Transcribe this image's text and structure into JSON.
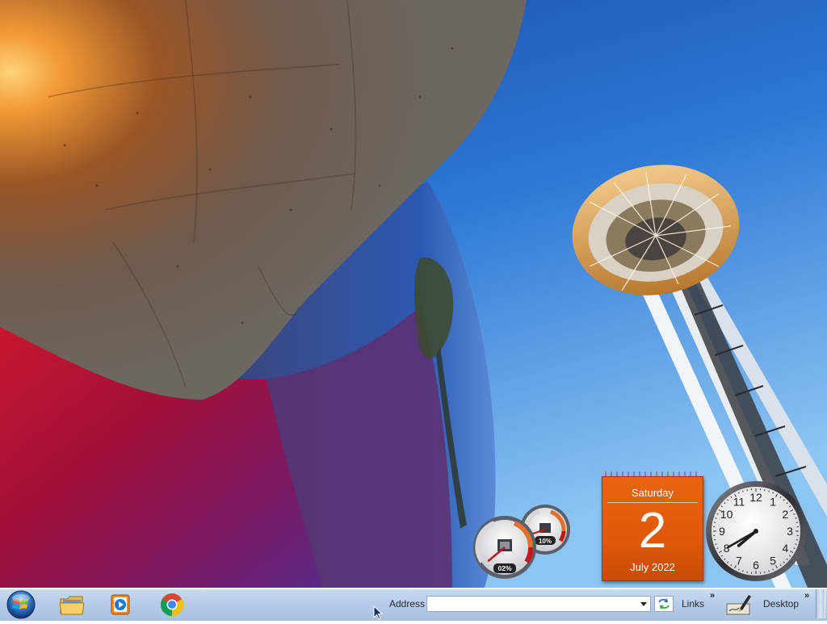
{
  "desktop": {
    "wallpaper": "seattle-space-needle-and-museum"
  },
  "gadgets": {
    "cpu_meter": {
      "cpu_label": "02%",
      "memory_label": "10%",
      "cpu_percent": 2,
      "memory_percent": 10
    },
    "calendar": {
      "weekday": "Saturday",
      "day": "2",
      "month_year": "July 2022",
      "color": "#e0600c"
    },
    "clock": {
      "numbers": [
        "12",
        "1",
        "2",
        "3",
        "4",
        "5",
        "6",
        "7",
        "8",
        "9",
        "10",
        "11"
      ],
      "hour": 7,
      "minute": 40
    }
  },
  "taskbar": {
    "start_icon": "windows-start-orb-icon",
    "pinned": [
      {
        "name": "Windows Explorer",
        "icon": "folder-icon"
      },
      {
        "name": "Windows Media Player",
        "icon": "media-player-icon"
      },
      {
        "name": "Google Chrome",
        "icon": "chrome-icon"
      }
    ],
    "address_label": "Address",
    "address_value": "",
    "links_label": "Links",
    "desktop_label": "Desktop",
    "chevron": "»",
    "colors": {
      "bar": "#b6cce8",
      "border": "#8ea6c8"
    }
  }
}
